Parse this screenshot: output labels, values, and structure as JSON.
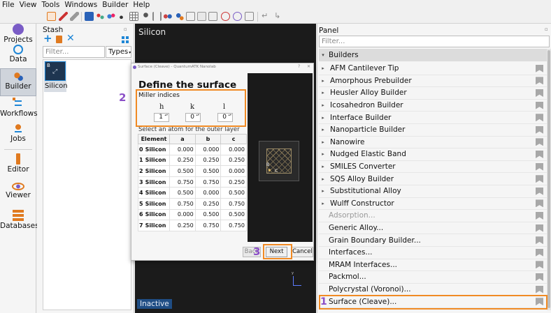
{
  "menu": [
    "File",
    "View",
    "Tools",
    "Windows",
    "Builder",
    "Help"
  ],
  "rail": [
    {
      "label": "Projects",
      "icon": "projects-icon"
    },
    {
      "label": "Data",
      "icon": "magnifier-icon"
    },
    {
      "label": "Builder",
      "icon": "builder-icon",
      "active": true
    },
    {
      "label": "Workflows",
      "icon": "workflows-icon"
    },
    {
      "label": "Jobs",
      "icon": "jobs-icon"
    },
    {
      "label": "Editor",
      "icon": "editor-icon"
    },
    {
      "label": "Viewer",
      "icon": "eye-icon"
    },
    {
      "label": "Databases",
      "icon": "databases-icon"
    }
  ],
  "stash": {
    "title": "Stash",
    "filter_placeholder": "Filter...",
    "types_label": "Types",
    "item": {
      "label": "Silicon",
      "thumb_letters": "B"
    }
  },
  "viewer": {
    "title": "Silicon",
    "badge": "Inactive"
  },
  "panel": {
    "title": "Panel",
    "filter_placeholder": "Filter...",
    "section": "Builders",
    "items": [
      {
        "label": "AFM Cantilever Tip",
        "expandable": true
      },
      {
        "label": "Amorphous Prebuilder",
        "expandable": true
      },
      {
        "label": "Heusler Alloy Builder",
        "expandable": true
      },
      {
        "label": "Icosahedron Builder",
        "expandable": true
      },
      {
        "label": "Interface Builder",
        "expandable": true
      },
      {
        "label": "Nanoparticle Builder",
        "expandable": true
      },
      {
        "label": "Nanowire",
        "expandable": true
      },
      {
        "label": "Nudged Elastic Band",
        "expandable": true
      },
      {
        "label": "SMILES Converter",
        "expandable": true
      },
      {
        "label": "SQS Alloy Builder",
        "expandable": true
      },
      {
        "label": "Substitutional Alloy",
        "expandable": true
      },
      {
        "label": "Wulff Constructor",
        "expandable": true
      },
      {
        "label": "Adsorption...",
        "expandable": false,
        "disabled": true
      },
      {
        "label": "Generic Alloy...",
        "expandable": false
      },
      {
        "label": "Grain Boundary Builder...",
        "expandable": false
      },
      {
        "label": "Interfaces...",
        "expandable": false
      },
      {
        "label": "MRAM Interfaces...",
        "expandable": false
      },
      {
        "label": "Packmol...",
        "expandable": false
      },
      {
        "label": "Polycrystal (Voronoi)...",
        "expandable": false
      },
      {
        "label": "Surface (Cleave)...",
        "expandable": false
      }
    ]
  },
  "dialog": {
    "window_title": "Surface (Cleave) - QuantumATK Nanolab",
    "heading": "Define the surface",
    "miller_label": "Miller indices",
    "h_label": "h",
    "k_label": "k",
    "l_label": "l",
    "h": "1",
    "k": "0",
    "l": "0",
    "outer_label": "Select an atom for the outer layer",
    "columns": [
      "Element",
      "a",
      "b",
      "c"
    ],
    "rows": [
      {
        "i": "0",
        "el": "Silicon",
        "a": "0.000",
        "b": "0.000",
        "c": "0.000"
      },
      {
        "i": "1",
        "el": "Silicon",
        "a": "0.250",
        "b": "0.250",
        "c": "0.250"
      },
      {
        "i": "2",
        "el": "Silicon",
        "a": "0.500",
        "b": "0.500",
        "c": "0.000"
      },
      {
        "i": "3",
        "el": "Silicon",
        "a": "0.750",
        "b": "0.750",
        "c": "0.250"
      },
      {
        "i": "4",
        "el": "Silicon",
        "a": "0.500",
        "b": "0.000",
        "c": "0.500"
      },
      {
        "i": "5",
        "el": "Silicon",
        "a": "0.750",
        "b": "0.250",
        "c": "0.750"
      },
      {
        "i": "6",
        "el": "Silicon",
        "a": "0.000",
        "b": "0.500",
        "c": "0.500"
      },
      {
        "i": "7",
        "el": "Silicon",
        "a": "0.250",
        "b": "0.750",
        "c": "0.750"
      }
    ],
    "back_label": "Back",
    "next_label": "Next",
    "cancel_label": "Cancel",
    "preview_labels": {
      "b": "B",
      "c": "C"
    }
  },
  "annotations": {
    "one": "1",
    "two": "2",
    "three": "3"
  },
  "colors": {
    "accent_orange": "#f08a24",
    "annotation_purple": "#8b4fc7",
    "viewer_bg": "#1b1b1b",
    "badge_blue": "#1f4d84"
  }
}
